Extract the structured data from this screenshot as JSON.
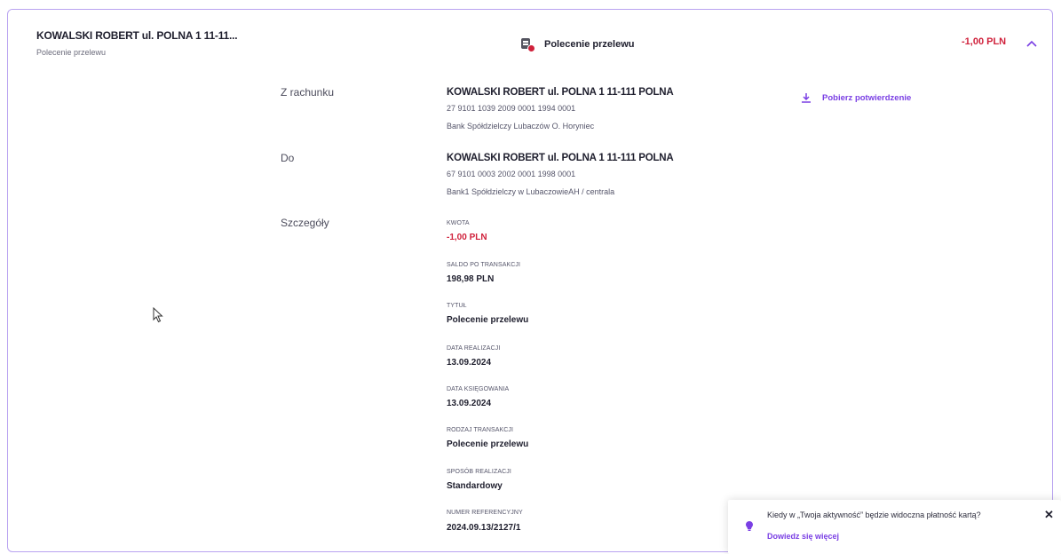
{
  "header": {
    "name": "KOWALSKI ROBERT ul. POLNA 1 11-11...",
    "subtitle": "Polecenie przelewu",
    "type_label": "Polecenie przelewu",
    "amount": "-1,00 PLN"
  },
  "sections": {
    "from_label": "Z rachunku",
    "to_label": "Do",
    "details_label": "Szczegóły"
  },
  "from": {
    "name": "KOWALSKI ROBERT ul. POLNA 1 11-111 POLNA",
    "account": "27 9101 1039 2009 0001 1994 0001",
    "bank": "Bank Spółdzielczy Lubaczów O. Horyniec"
  },
  "to": {
    "name": "KOWALSKI ROBERT ul. POLNA 1 11-111 POLNA",
    "account": "67 9101 0003 2002 0001 1998 0001",
    "bank": "Bank1 Spółdzielczy w LubaczowieAH / centrala"
  },
  "download_label": "Pobierz potwierdzenie",
  "details": [
    {
      "label": "KWOTA",
      "value": "-1,00 PLN"
    },
    {
      "label": "SALDO PO TRANSAKCJI",
      "value": "198,98 PLN"
    },
    {
      "label": "TYTUŁ",
      "value": "Polecenie przelewu"
    },
    {
      "label": "DATA REALIZACJI",
      "value": "13.09.2024"
    },
    {
      "label": "DATA KSIĘGOWANIA",
      "value": "13.09.2024"
    },
    {
      "label": "RODZAJ TRANSAKCJI",
      "value": "Polecenie przelewu"
    },
    {
      "label": "SPOSÓB REALIZACJI",
      "value": "Standardowy"
    },
    {
      "label": "NUMER REFERENCYJNY",
      "value": "2024.09.13/2127/1"
    }
  ],
  "toast": {
    "message": "Kiedy w „Twoja aktywność” będzie widoczna płatność kartą?",
    "link": "Dowiedz się więcej",
    "close": "✕"
  },
  "colors": {
    "accent": "#7a3fe4",
    "negative": "#d0213b",
    "border": "#b9a3f0"
  }
}
